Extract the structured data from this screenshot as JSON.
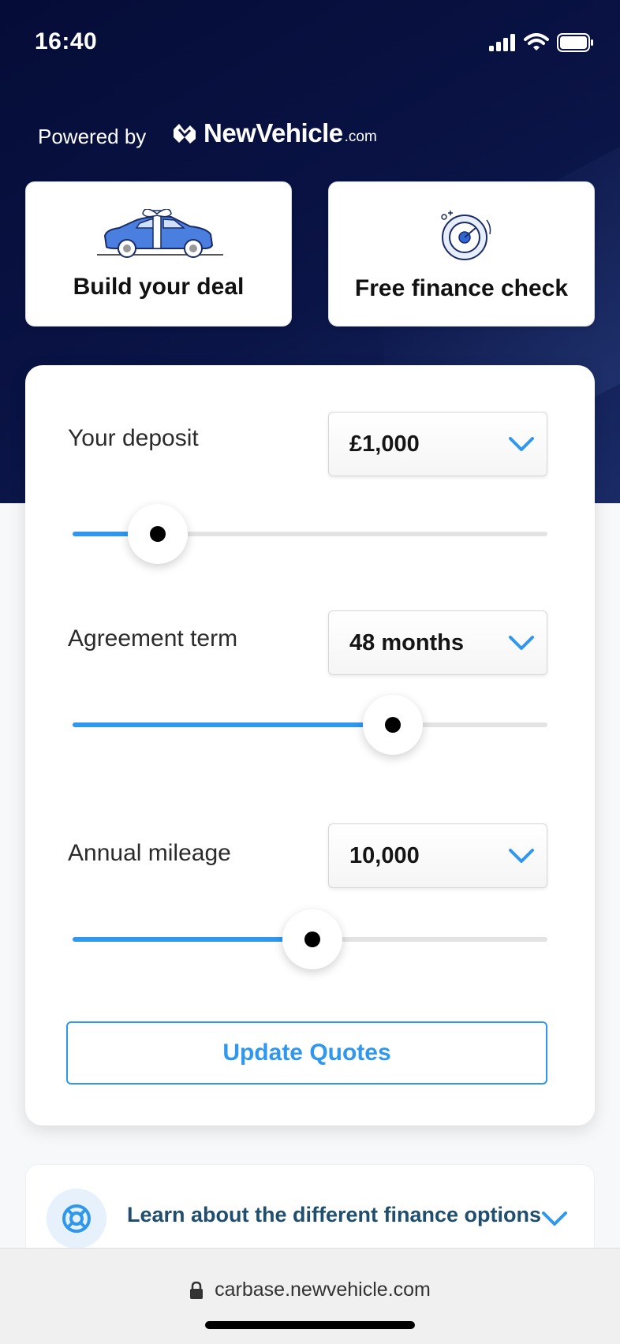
{
  "status": {
    "time": "16:40"
  },
  "header": {
    "powered_by": "Powered by",
    "brand_name": "NewVehicle",
    "brand_tld": ".com"
  },
  "tiles": [
    {
      "label": "Build your deal",
      "icon": "car-with-bow-icon"
    },
    {
      "label": "Free finance check",
      "icon": "credit-check-dial-icon"
    }
  ],
  "calculator": {
    "deposit": {
      "label": "Your deposit",
      "value": "£1,000",
      "slider_fraction": 0.18
    },
    "term": {
      "label": "Agreement term",
      "value": "48 months",
      "slider_fraction": 0.675
    },
    "mileage": {
      "label": "Annual mileage",
      "value": "10,000",
      "slider_fraction": 0.505
    },
    "update_label": "Update Quotes"
  },
  "learn": {
    "label": "Learn about the different finance options",
    "icon": "lifebuoy-icon"
  },
  "browser": {
    "url": "carbase.newvehicle.com",
    "icon": "lock-icon"
  },
  "colors": {
    "accent": "#2f97ee",
    "header_bg": "#050c37",
    "learn_text": "#1f4e6e"
  }
}
